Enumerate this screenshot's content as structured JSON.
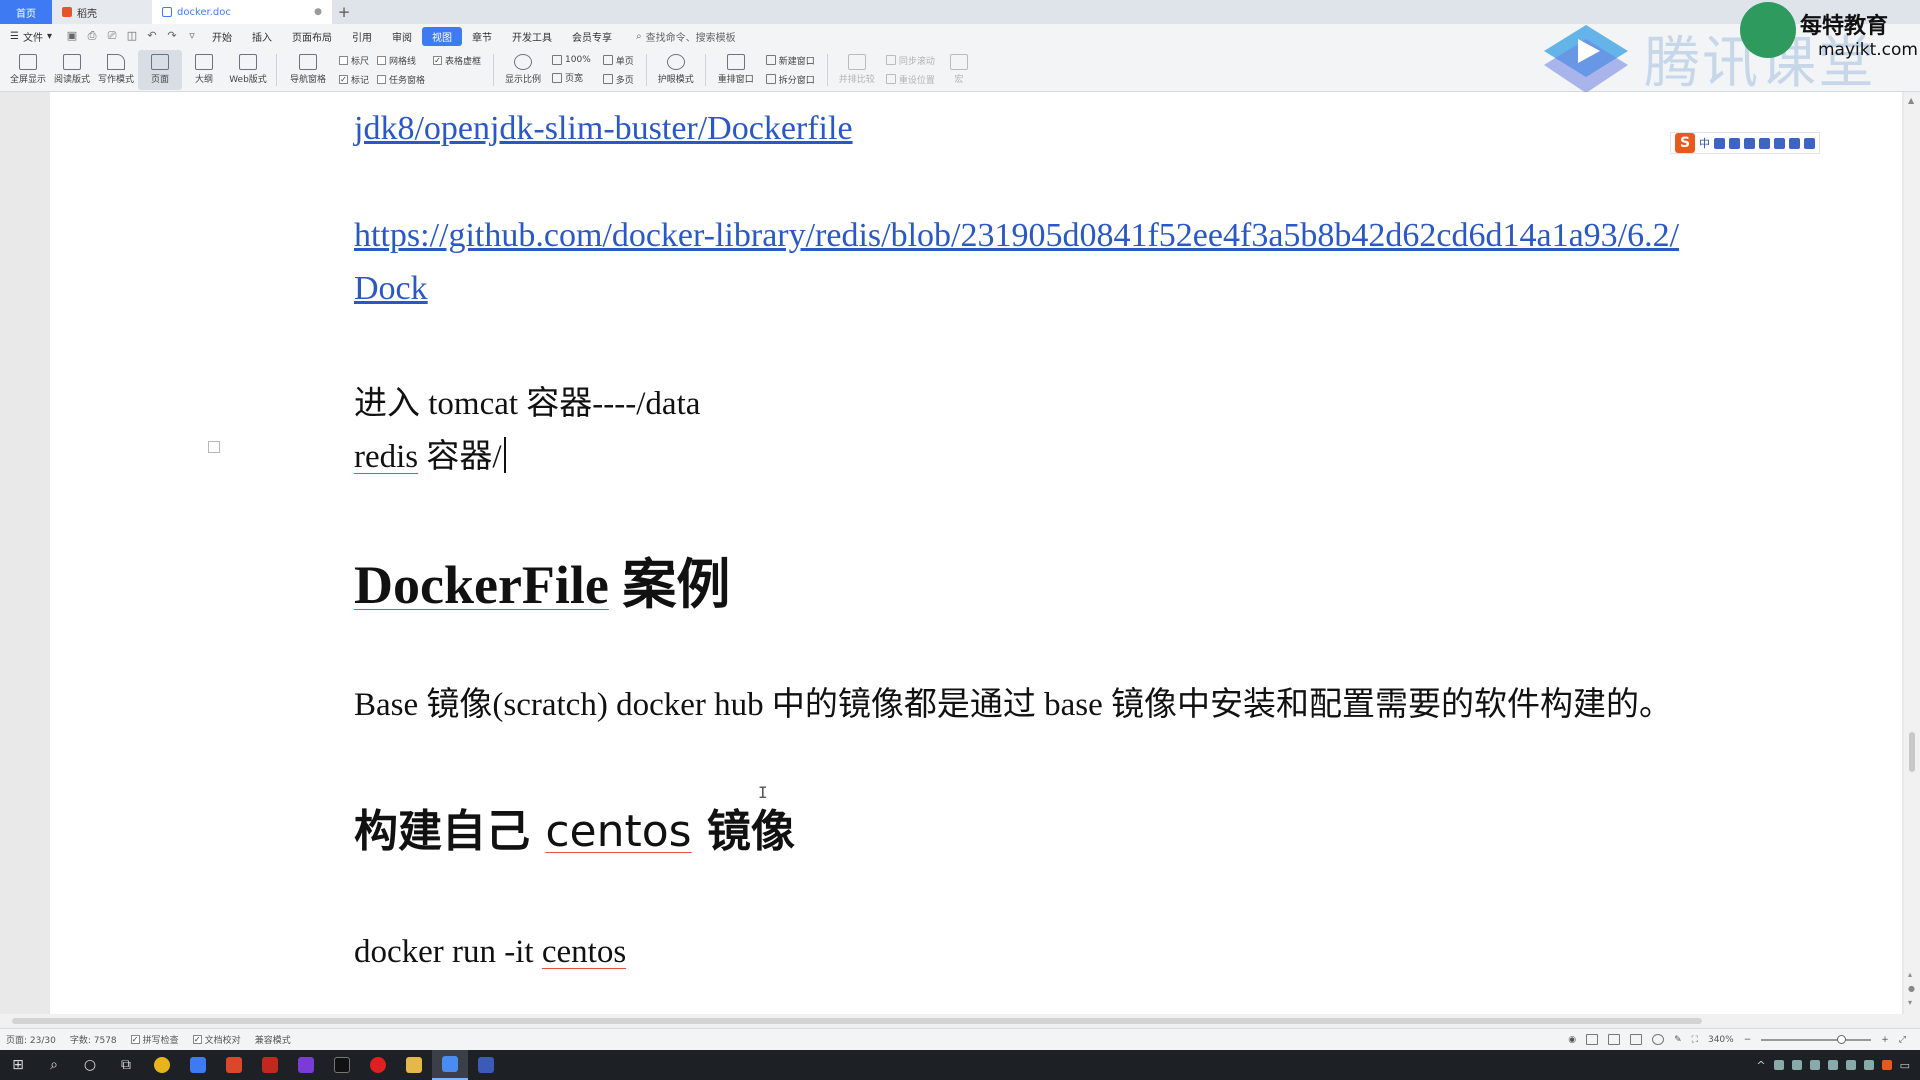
{
  "titlebar": {
    "tabs": [
      {
        "label": "首页"
      },
      {
        "label": "稻壳"
      },
      {
        "label": "docker.doc"
      }
    ]
  },
  "menubar": {
    "file_label": "文件",
    "items": [
      "开始",
      "插入",
      "页面布局",
      "引用",
      "审阅",
      "视图",
      "章节",
      "开发工具",
      "会员专享"
    ],
    "active_item": "视图",
    "search_placeholder": "查找命令、搜索模板"
  },
  "ribbon": {
    "buttons": [
      "全屏显示",
      "阅读版式",
      "写作模式",
      "页面",
      "大纲",
      "Web版式"
    ],
    "nav_pane": "导航窗格",
    "checks": [
      {
        "label": "标尺",
        "checked": false
      },
      {
        "label": "网格线",
        "checked": false
      },
      {
        "label": "表格虚框",
        "checked": true
      },
      {
        "label": "标记",
        "checked": true
      },
      {
        "label": "任务窗格",
        "checked": false
      }
    ],
    "zoom_label": "显示比例",
    "zoom_100": "100%",
    "single_page": "单页",
    "page_width": "页宽",
    "multi_page": "多页",
    "eye_mode": "护眼模式",
    "rearrange_window": "重排窗口",
    "new_window": "新建窗口",
    "split_window": "拆分窗口",
    "side_by_side": "并排比较",
    "sync_scroll": "同步滚动",
    "reset_position": "重设位置",
    "macro": "宏"
  },
  "watermark": {
    "platform": "腾讯课堂",
    "brand_name": "每特教育",
    "brand_url": "mayikt.com"
  },
  "ime": {
    "label": "中"
  },
  "document": {
    "link1": "jdk8/openjdk-slim-buster/Dockerfile",
    "link2_line1": "https://github.com/docker-library/redis/blob/231905d0841f52ee4f3a5b8b42d62cd6d14a1a93/6.2/",
    "link2_line2": "Dock",
    "para1_line1": "进入 tomcat  容器----/data",
    "para1_line2_word": "redis",
    "para1_line2_rest": " 容器/",
    "heading1_word": "DockerFile",
    "heading1_rest": " 案例",
    "para2": "Base 镜像(scratch) docker hub 中的镜像都是通过 base 镜像中安装和配置需要的软件构建的。",
    "heading2_pre": "构建自己 ",
    "heading2_word": "centos",
    "heading2_post": " 镜像",
    "para3_pre": "docker run -it ",
    "para3_word": "centos"
  },
  "statusbar": {
    "page": "页面: 23/30",
    "words": "字数: 7578",
    "spell_check": "拼写检查",
    "doc_proof": "文档校对",
    "compat_mode": "兼容模式",
    "zoom": "340%"
  }
}
